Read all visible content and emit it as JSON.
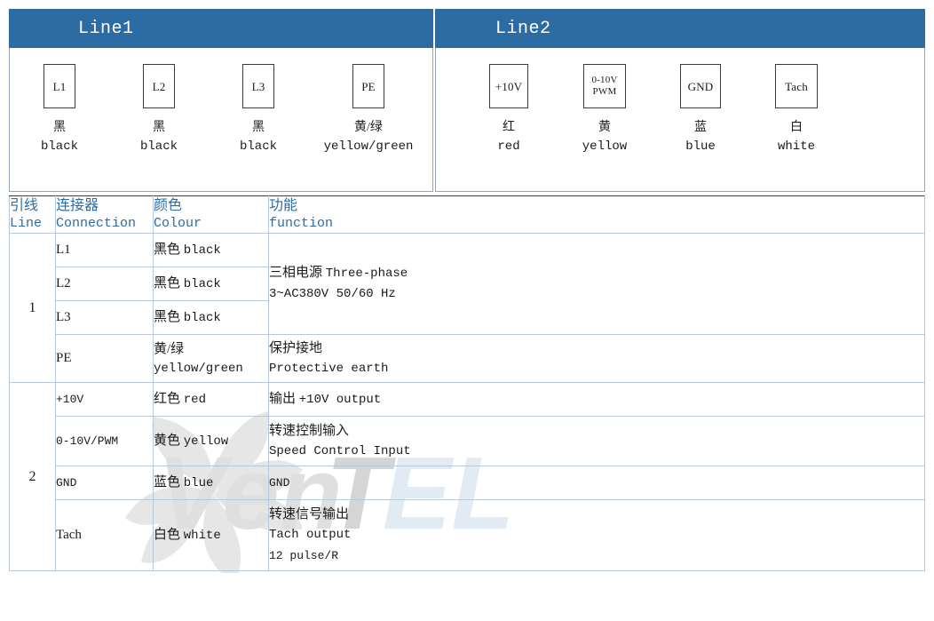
{
  "panels": [
    {
      "id": "line1",
      "title": "Line1",
      "connectors": [
        {
          "box_lines": [
            "L1"
          ],
          "cn": "黑",
          "en": "black"
        },
        {
          "box_lines": [
            "L2"
          ],
          "cn": "黑",
          "en": "black"
        },
        {
          "box_lines": [
            "L3"
          ],
          "cn": "黑",
          "en": "black"
        },
        {
          "box_lines": [
            "PE"
          ],
          "cn": "黄/绿",
          "en": "yellow/green"
        }
      ]
    },
    {
      "id": "line2",
      "title": "Line2",
      "connectors": [
        {
          "box_lines": [
            "+10V"
          ],
          "cn": "红",
          "en": "red"
        },
        {
          "box_lines": [
            "0-10V",
            "PWM"
          ],
          "cn": "黄",
          "en": "yellow"
        },
        {
          "box_lines": [
            "GND"
          ],
          "cn": "蓝",
          "en": "blue"
        },
        {
          "box_lines": [
            "Tach"
          ],
          "cn": "白",
          "en": "white"
        }
      ]
    }
  ],
  "table": {
    "headers": {
      "line_cn": "引线",
      "line_en": "Line",
      "connection_cn": "连接器",
      "connection_en": "Connection",
      "colour_cn": "颜色",
      "colour_en": "Colour",
      "function_cn": "功能",
      "function_en": "function"
    },
    "groups": [
      {
        "line": "1",
        "rows": [
          {
            "connection": "L1",
            "colour_cn": "黑色",
            "colour_en": "black",
            "function_cn": "",
            "function_en": ""
          },
          {
            "connection": "L2",
            "colour_cn": "黑色",
            "colour_en": "black",
            "function_cn": "三相电源",
            "function_en": "Three-phase",
            "function_line2": "3~AC380V 50/60 Hz"
          },
          {
            "connection": "L3",
            "colour_cn": "黑色",
            "colour_en": "black",
            "function_cn": "",
            "function_en": ""
          },
          {
            "connection": "PE",
            "colour_cn": "黄/绿",
            "colour_en": "yellow/green",
            "function_cn": "保护接地",
            "function_en": "Protective earth"
          }
        ]
      },
      {
        "line": "2",
        "rows": [
          {
            "connection": "+10V",
            "colour_cn": "红色",
            "colour_en": "red",
            "function_cn": "输出",
            "function_en": "+10V output"
          },
          {
            "connection": "0-10V/PWM",
            "colour_cn": "黄色",
            "colour_en": "yellow",
            "function_cn": "转速控制输入",
            "function_en": "Speed Control Input"
          },
          {
            "connection": "GND",
            "colour_cn": "蓝色",
            "colour_en": "blue",
            "function_cn": "",
            "function_en": "GND"
          },
          {
            "connection": "Tach",
            "colour_cn": "白色",
            "colour_en": "white",
            "function_cn": "转速信号输出",
            "function_en": "Tach output",
            "function_line3": "12 pulse/R"
          }
        ]
      }
    ]
  },
  "watermark": {
    "text_dark": "Ven",
    "text_mid": "T",
    "text_light": "EL"
  },
  "colors": {
    "header_blue": "#2d6ba3",
    "header_text_blue": "#2d6ba3",
    "grid_line": "#b9c8d8",
    "box_border": "#3a3a3a",
    "watermark_gray": "#cccccc",
    "watermark_blue": "#c9dced"
  }
}
